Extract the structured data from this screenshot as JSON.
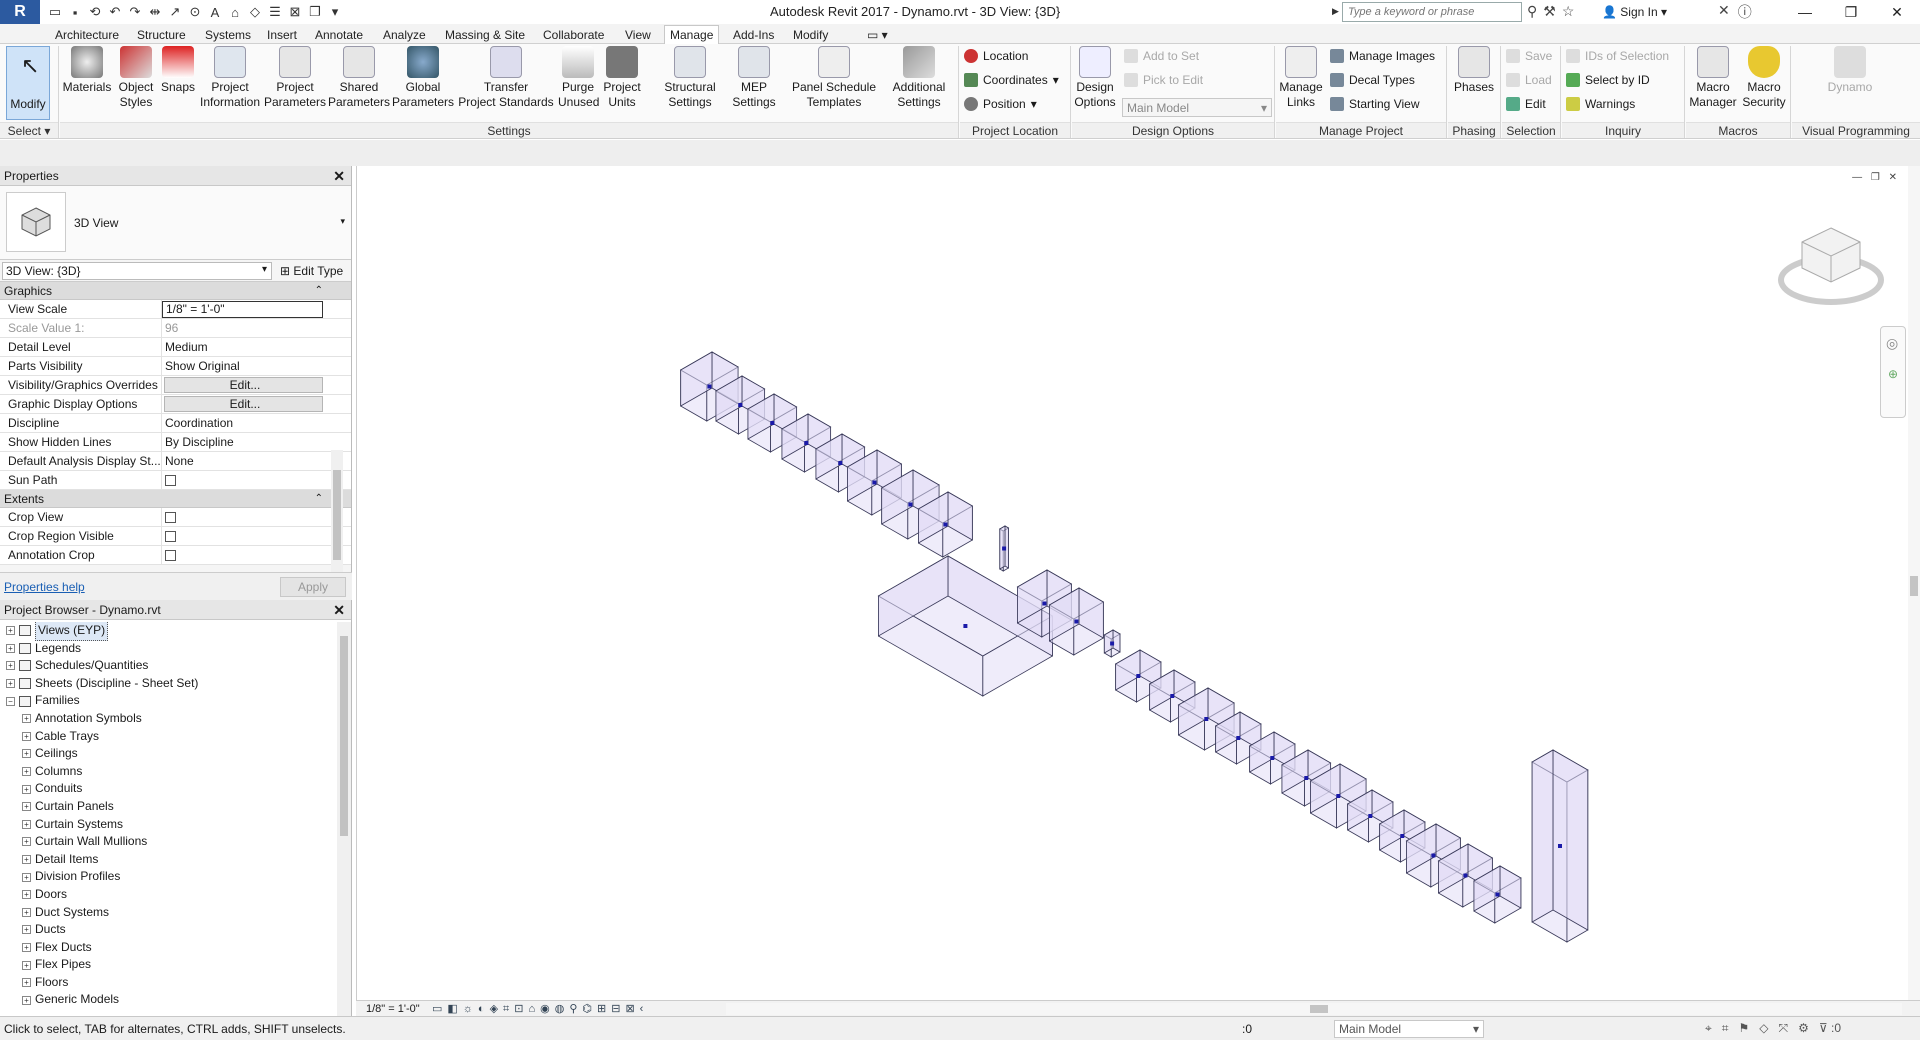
{
  "titlebar": {
    "app_title": "Autodesk Revit 2017 -     Dynamo.rvt - 3D View: {3D}",
    "search_placeholder": "Type a keyword or phrase",
    "sign_in": "Sign In"
  },
  "tabs": [
    "Architecture",
    "Structure",
    "Systems",
    "Insert",
    "Annotate",
    "Analyze",
    "Massing & Site",
    "Collaborate",
    "View",
    "Manage",
    "Add-Ins",
    "Modify"
  ],
  "active_tab": "Manage",
  "ribbon": {
    "select_label": "Select",
    "modify": "Modify",
    "buttons": [
      {
        "id": "materials",
        "label": "Materials"
      },
      {
        "id": "object-styles",
        "label": "Object\nStyles"
      },
      {
        "id": "snaps",
        "label": "Snaps"
      },
      {
        "id": "project-information",
        "label": "Project\nInformation"
      },
      {
        "id": "project-parameters",
        "label": "Project\nParameters"
      },
      {
        "id": "shared-parameters",
        "label": "Shared\nParameters"
      },
      {
        "id": "global-parameters",
        "label": "Global\nParameters"
      },
      {
        "id": "transfer-project-standards",
        "label": "Transfer\nProject Standards"
      },
      {
        "id": "purge-unused",
        "label": "Purge\nUnused"
      },
      {
        "id": "project-units",
        "label": "Project\nUnits"
      },
      {
        "id": "structural-settings",
        "label": "Structural\nSettings"
      },
      {
        "id": "mep-settings",
        "label": "MEP\nSettings"
      },
      {
        "id": "panel-schedule-templates",
        "label": "Panel Schedule\nTemplates"
      },
      {
        "id": "additional-settings",
        "label": "Additional\nSettings"
      }
    ],
    "location": {
      "location": "Location",
      "coordinates": "Coordinates",
      "position": "Position"
    },
    "design_options": {
      "label": "Design\nOptions",
      "add_to_set": "Add to Set",
      "pick_to_edit": "Pick to Edit",
      "main_model": "Main Model"
    },
    "manage_project": {
      "manage_links": "Manage\nLinks",
      "manage_images": "Manage  Images",
      "decal_types": "Decal  Types",
      "starting_view": "Starting  View"
    },
    "phasing": {
      "phases": "Phases"
    },
    "selection": {
      "save": "Save",
      "load": "Load",
      "edit": "Edit"
    },
    "inquiry": {
      "ids_of_selection": "IDs of  Selection",
      "select_by_id": "Select  by ID",
      "warnings": "Warnings"
    },
    "macros": {
      "macro_manager": "Macro\nManager",
      "macro_security": "Macro\nSecurity"
    },
    "visual_programming": {
      "dynamo": "Dynamo"
    },
    "panels": [
      {
        "id": "select",
        "label": "Select"
      },
      {
        "id": "settings",
        "label": "Settings"
      },
      {
        "id": "project-location",
        "label": "Project Location"
      },
      {
        "id": "design-options",
        "label": "Design Options"
      },
      {
        "id": "manage-project",
        "label": "Manage Project"
      },
      {
        "id": "phasing",
        "label": "Phasing"
      },
      {
        "id": "selection",
        "label": "Selection"
      },
      {
        "id": "inquiry",
        "label": "Inquiry"
      },
      {
        "id": "macros",
        "label": "Macros"
      },
      {
        "id": "visual-programming",
        "label": "Visual Programming"
      }
    ]
  },
  "properties": {
    "title": "Properties",
    "type_name": "3D View",
    "view_selector": "3D View: {3D}",
    "edit_type": "Edit Type",
    "groups": [
      {
        "name": "Graphics",
        "rows": [
          {
            "k": "View Scale",
            "v": "1/8\" = 1'-0\"",
            "style": "boxed"
          },
          {
            "k": "Scale Value    1:",
            "v": "96",
            "style": "grey"
          },
          {
            "k": "Detail Level",
            "v": "Medium"
          },
          {
            "k": "Parts Visibility",
            "v": "Show Original"
          },
          {
            "k": "Visibility/Graphics Overrides",
            "v": "Edit...",
            "style": "btn"
          },
          {
            "k": "Graphic Display Options",
            "v": "Edit...",
            "style": "btn"
          },
          {
            "k": "Discipline",
            "v": "Coordination"
          },
          {
            "k": "Show Hidden Lines",
            "v": "By Discipline"
          },
          {
            "k": "Default Analysis Display St...",
            "v": "None"
          },
          {
            "k": "Sun Path",
            "v": "",
            "style": "check"
          }
        ]
      },
      {
        "name": "Extents",
        "rows": [
          {
            "k": "Crop View",
            "v": "",
            "style": "check"
          },
          {
            "k": "Crop Region Visible",
            "v": "",
            "style": "check"
          },
          {
            "k": "Annotation Crop",
            "v": "",
            "style": "check"
          }
        ]
      }
    ],
    "help": "Properties help",
    "apply": "Apply"
  },
  "browser": {
    "title": "Project Browser - Dynamo.rvt",
    "nodes": [
      {
        "label": "Views (EYP)",
        "level": 0,
        "selected": true
      },
      {
        "label": "Legends",
        "level": 0
      },
      {
        "label": "Schedules/Quantities",
        "level": 0
      },
      {
        "label": "Sheets (Discipline - Sheet Set)",
        "level": 0
      },
      {
        "label": "Families",
        "level": 0,
        "open": true
      },
      {
        "label": "Annotation Symbols",
        "level": 1
      },
      {
        "label": "Cable Trays",
        "level": 1
      },
      {
        "label": "Ceilings",
        "level": 1
      },
      {
        "label": "Columns",
        "level": 1
      },
      {
        "label": "Conduits",
        "level": 1
      },
      {
        "label": "Curtain Panels",
        "level": 1
      },
      {
        "label": "Curtain Systems",
        "level": 1
      },
      {
        "label": "Curtain Wall Mullions",
        "level": 1
      },
      {
        "label": "Detail Items",
        "level": 1
      },
      {
        "label": "Division Profiles",
        "level": 1
      },
      {
        "label": "Doors",
        "level": 1
      },
      {
        "label": "Duct Systems",
        "level": 1
      },
      {
        "label": "Ducts",
        "level": 1
      },
      {
        "label": "Flex Ducts",
        "level": 1
      },
      {
        "label": "Flex Pipes",
        "level": 1
      },
      {
        "label": "Floors",
        "level": 1
      },
      {
        "label": "Generic Models",
        "level": 1
      }
    ]
  },
  "view_control": {
    "scale": "1/8\" = 1'-0\""
  },
  "status": {
    "text": "Click to select, TAB for alternates, CTRL adds, SHIFT unselects.",
    "zero": ":0",
    "model": "Main Model",
    "filter": ":0"
  },
  "colors": {
    "accent": "#2c5aa0",
    "box_fill": "#e2ddf6",
    "box_stroke": "#3a3a5a",
    "marker": "#1a1aa8"
  }
}
